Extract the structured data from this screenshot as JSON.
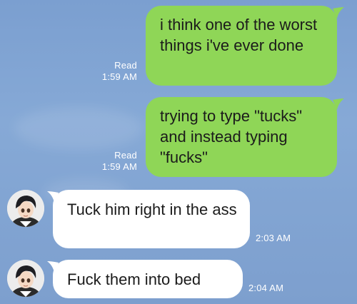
{
  "messages": [
    {
      "direction": "outgoing",
      "text": "i think one of the worst things i've ever done",
      "read_label": "Read",
      "time": "1:59 AM"
    },
    {
      "direction": "outgoing",
      "text": "trying to type \"tucks\" and instead typing \"fucks\"",
      "read_label": "Read",
      "time": "1:59 AM"
    },
    {
      "direction": "incoming",
      "text": "Tuck him right in the ass",
      "time": "2:03 AM",
      "avatar_icon": "avatar-anime-figure-icon"
    },
    {
      "direction": "incoming",
      "text": "Fuck them into bed",
      "time": "2:04 AM",
      "avatar_icon": "avatar-anime-figure-icon"
    }
  ],
  "colors": {
    "background": "#7d9fce",
    "outgoing_bubble": "#8fd657",
    "incoming_bubble": "#ffffff",
    "meta_text": "#ffffff"
  }
}
